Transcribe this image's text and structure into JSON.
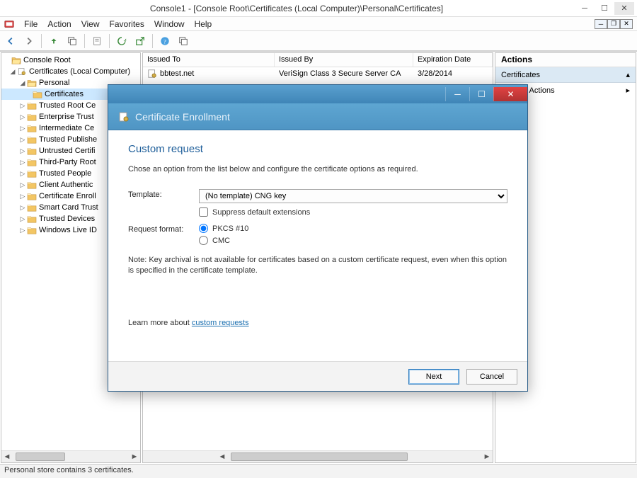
{
  "title": "Console1 - [Console Root\\Certificates (Local Computer)\\Personal\\Certificates]",
  "menu": {
    "file": "File",
    "action": "Action",
    "view": "View",
    "favorites": "Favorites",
    "window": "Window",
    "help": "Help"
  },
  "tree": {
    "root": "Console Root",
    "lvl1": "Certificates (Local Computer)",
    "items": [
      "Personal",
      "Certificates",
      "Trusted Root Ce",
      "Enterprise Trust",
      "Intermediate Ce",
      "Trusted Publishe",
      "Untrusted Certifi",
      "Third-Party Root",
      "Trusted People",
      "Client Authentic",
      "Certificate Enroll",
      "Smart Card Trust",
      "Trusted Devices",
      "Windows Live ID"
    ]
  },
  "list": {
    "cols": {
      "issued_to": "Issued To",
      "issued_by": "Issued By",
      "expiration": "Expiration Date"
    },
    "row1": {
      "issued_to": "bbtest.net",
      "issued_by": "VeriSign Class 3 Secure Server CA",
      "expiration": "3/28/2014"
    }
  },
  "actions": {
    "header": "Actions",
    "sub": "Certificates",
    "item1": "More Actions"
  },
  "statusbar": "Personal store contains 3 certificates.",
  "dialog": {
    "header": "Certificate Enrollment",
    "title": "Custom request",
    "intro": "Chose an option from the list below and configure the certificate options as required.",
    "template_label": "Template:",
    "template_value": "(No template) CNG key",
    "suppress": "Suppress default extensions",
    "reqfmt_label": "Request format:",
    "pkcs": "PKCS #10",
    "cmc": "CMC",
    "note": "Note: Key archival is not available for certificates based on a custom certificate request, even when this option is specified in the certificate template.",
    "learn_prefix": "Learn more about ",
    "learn_link": "custom requests",
    "next": "Next",
    "cancel": "Cancel"
  }
}
